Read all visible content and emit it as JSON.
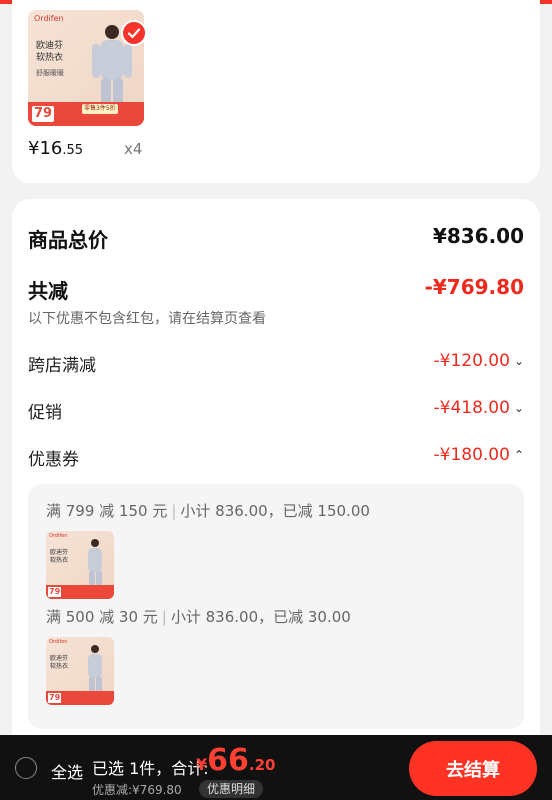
{
  "colors": {
    "accent": "#ee2a1e",
    "checkout": "#ff3324",
    "bottom_bar": "#111111"
  },
  "product": {
    "brand": "Ordifen",
    "image_name": "欧迪芬\n软热衣",
    "image_sub": "舒服暖暖",
    "image_price": "79",
    "image_tag": "零售3件5折",
    "price_int": "¥16",
    "price_dec": ".55",
    "qty": "x4"
  },
  "summary": {
    "total_label": "商品总价",
    "total_value": "¥836.00",
    "reduce_label": "共减",
    "reduce_value": "-¥769.80",
    "note": "以下优惠不包含红包，请在结算页查看",
    "items": [
      {
        "label": "跨店满减",
        "value": "-¥120.00",
        "chevron": "⌄"
      },
      {
        "label": "促销",
        "value": "-¥418.00",
        "chevron": "⌄"
      },
      {
        "label": "优惠券",
        "value": "-¥180.00",
        "chevron": "⌃"
      }
    ]
  },
  "coupons": [
    {
      "rule": "满 799 减 150 元",
      "detail": "小计 836.00，已减 150.00"
    },
    {
      "rule": "满 500 减 30 元",
      "detail": "小计 836.00，已减 30.00"
    }
  ],
  "bottom": {
    "select_all": "全选",
    "selected_prefix": "已选 1件，合计:",
    "currency": "¥",
    "total_int": "66",
    "total_dec": ".20",
    "discount": "优惠减:¥769.80",
    "detail_button": "优惠明细",
    "checkout_button": "去结算"
  }
}
